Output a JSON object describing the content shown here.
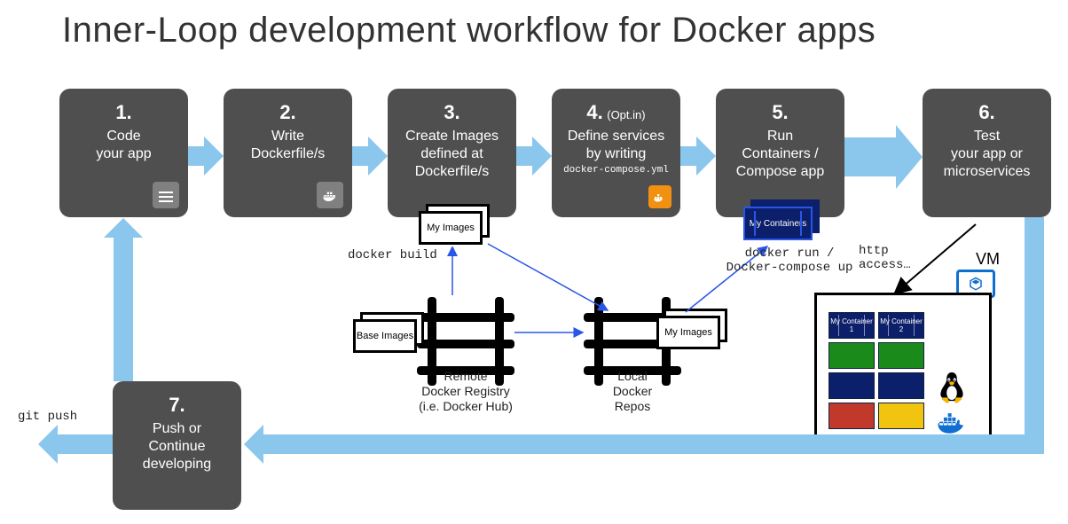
{
  "title": "Inner-Loop development workflow for Docker apps",
  "steps": [
    {
      "num": "1.",
      "label": "Code\nyour app"
    },
    {
      "num": "2.",
      "label": "Write\nDockerfile/s"
    },
    {
      "num": "3.",
      "label": "Create Images\ndefined at\nDockerfile/s"
    },
    {
      "num": "4.",
      "optin": "(Opt.in)",
      "label": "Define services\nby writing",
      "sub": "docker-compose.yml"
    },
    {
      "num": "5.",
      "label": "Run\nContainers /\nCompose app"
    },
    {
      "num": "6.",
      "label": "Test\nyour app or\nmicroservices"
    },
    {
      "num": "7.",
      "label": "Push or\nContinue\ndeveloping"
    }
  ],
  "labels": {
    "docker_build": "docker build",
    "docker_run": "docker run /\nDocker-compose up",
    "http_access": "http\naccess…",
    "git_push": "git push",
    "remote_registry": "Remote\nDocker Registry\n(i.e. Docker Hub)",
    "local_repos": "Local\nDocker\nRepos",
    "vm": "VM",
    "my_images": "My\nImages",
    "base_images": "Base\nImages",
    "my_containers": "My\nContainers",
    "my_container_1": "My\nContainer 1",
    "my_container_2": "My\nContainer 2"
  },
  "vm_containers": {
    "row1_color_a": "#0c1f6a",
    "row1_color_b": "#0c1f6a",
    "row2_color_a": "#1a8a1a",
    "row2_color_b": "#1a8a1a",
    "row3_color_a": "#0c1f6a",
    "row3_color_b": "#0c1f6a",
    "row4_color_a": "#c0392b",
    "row4_color_b": "#f1c40f"
  }
}
